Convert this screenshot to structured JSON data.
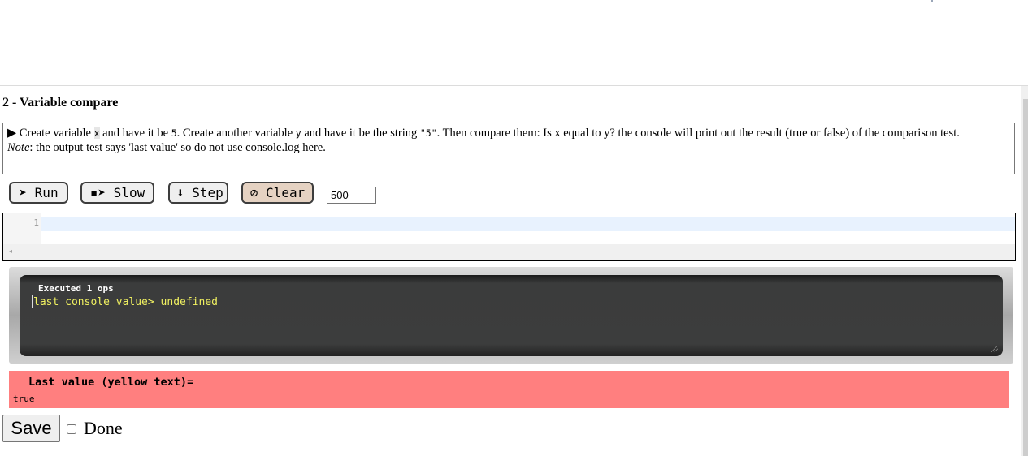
{
  "exercise": {
    "title": "2 - Variable compare",
    "instructions": {
      "marker": "▶",
      "part1": "Create variable ",
      "var_x": "x",
      "part2": " and have it be ",
      "val_5": "5",
      "part3": ". Create another variable ",
      "var_y": "y",
      "part4": " and have it be the string ",
      "val_str5": "\"5\"",
      "part5": ". Then compare them: Is x equal to y? the console will print out the result (true or false) of the comparison test.",
      "note_label": "Note",
      "note_text": ": the output test says 'last value' so do not use console.log here."
    }
  },
  "toolbar": {
    "run_label": "➤ Run",
    "slow_label": "▪➤ Slow",
    "step_label": "⬇ Step",
    "clear_label": "⊘ Clear",
    "speed_value": "500"
  },
  "editor": {
    "line_number": "1",
    "left_arrow_icon": "◂"
  },
  "console": {
    "executed": "Executed 1 ops",
    "prefix": "last console value> ",
    "value": "undefined"
  },
  "expected": {
    "label": "Last value (yellow text)=",
    "value": "true"
  },
  "footer": {
    "save_label": "Save",
    "done_label": "Done",
    "done_checked": false
  },
  "colors": {
    "result_bg": "#ff7f7f",
    "console_text": "#f0f060",
    "console_bg": "#3c3d3d"
  }
}
